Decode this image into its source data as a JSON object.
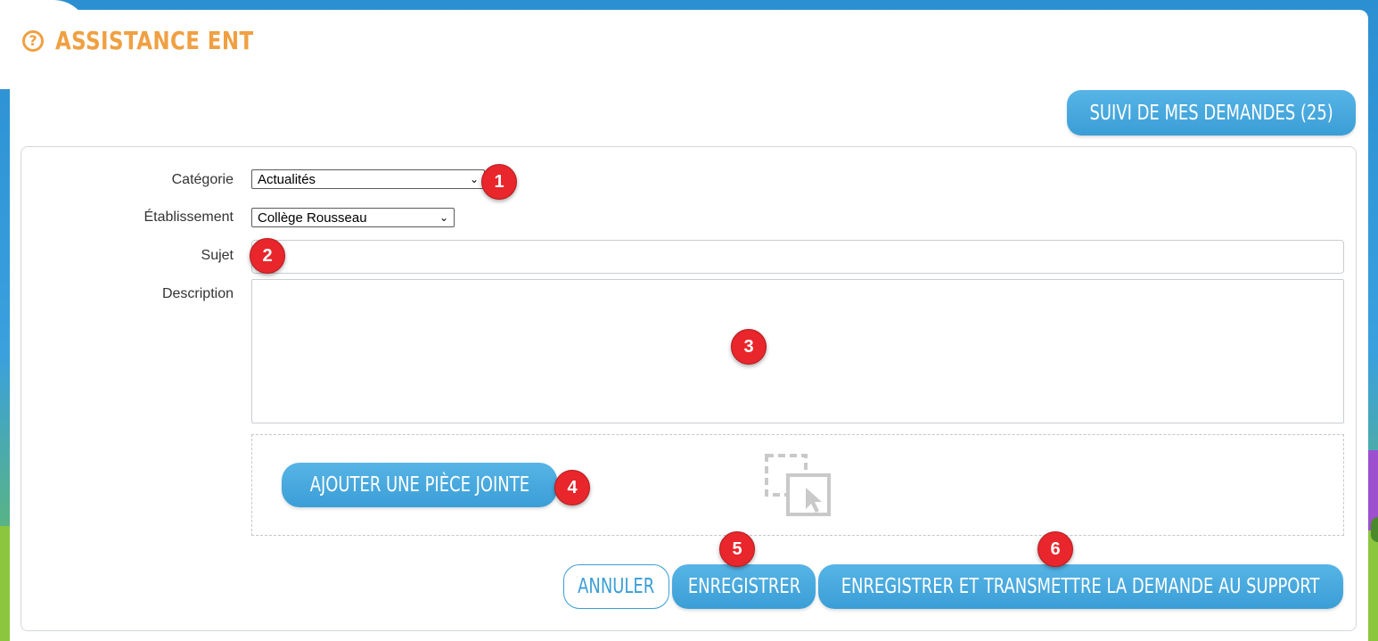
{
  "page": {
    "title": "ASSISTANCE ENT",
    "title_icon": "question-circle-icon",
    "accent_color": "#f0a042",
    "button_color": "#3a9ed6"
  },
  "header": {
    "tracking_button_label": "SUIVI DE MES DEMANDES (25)"
  },
  "form": {
    "category_label": "Catégorie",
    "category_value": "Actualités",
    "establishment_label": "Établissement",
    "establishment_value": "Collège Rousseau",
    "subject_label": "Sujet",
    "subject_value": "",
    "description_label": "Description",
    "description_value": "",
    "attach_button_label": "AJOUTER UNE PIÈCE JOINTE",
    "drop_icon": "drag-drop-icon"
  },
  "actions": {
    "cancel_label": "ANNULER",
    "save_label": "ENREGISTRER",
    "save_send_label": "ENREGISTRER ET TRANSMETTRE LA DEMANDE AU SUPPORT"
  },
  "markers": [
    "1",
    "2",
    "3",
    "4",
    "5",
    "6"
  ],
  "marker_color": "#e8262b"
}
